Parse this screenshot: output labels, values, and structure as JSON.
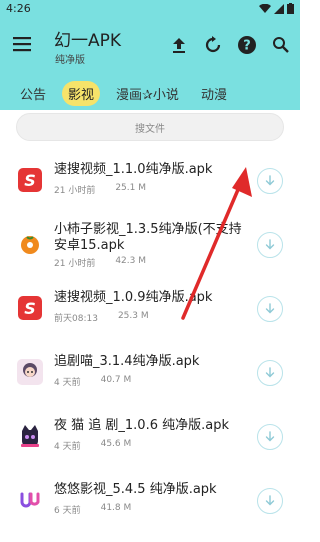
{
  "status": {
    "time": "4:26"
  },
  "appbar": {
    "title": "幻一APK",
    "subtitle": "纯净版"
  },
  "tabs": [
    {
      "label": "公告",
      "active": false
    },
    {
      "label": "影视",
      "active": true
    },
    {
      "label": "漫画✰小说",
      "active": false
    },
    {
      "label": "动漫",
      "active": false
    }
  ],
  "search": {
    "placeholder": "搜文件"
  },
  "files": [
    {
      "name": "速搜视频_1.1.0纯净版.apk",
      "time": "21 小时前",
      "size": "25.1 M",
      "icon": "sousou-s-icon"
    },
    {
      "name": "小柿子影视_1.3.5纯净版(不支持安卓15.apk",
      "time": "21 小时前",
      "size": "42.3 M",
      "icon": "persimmon-icon"
    },
    {
      "name": "速搜视频_1.0.9纯净版.apk",
      "time": "前天08:13",
      "size": "25.3 M",
      "icon": "sousou-s-icon"
    },
    {
      "name": "追剧喵_3.1.4纯净版.apk",
      "time": "4 天前",
      "size": "40.7 M",
      "icon": "anime-girl-icon"
    },
    {
      "name": "夜 猫 追 剧_1.0.6 纯净版.apk",
      "time": "4 天前",
      "size": "45.6 M",
      "icon": "night-cat-icon"
    },
    {
      "name": "悠悠影视_5.4.5 纯净版.apk",
      "time": "6 天前",
      "size": "41.8 M",
      "icon": "youyou-icon"
    }
  ],
  "colors": {
    "header": "#7ae0e0",
    "active_tab": "#f6e36a",
    "arrow": "#e02a2a"
  }
}
